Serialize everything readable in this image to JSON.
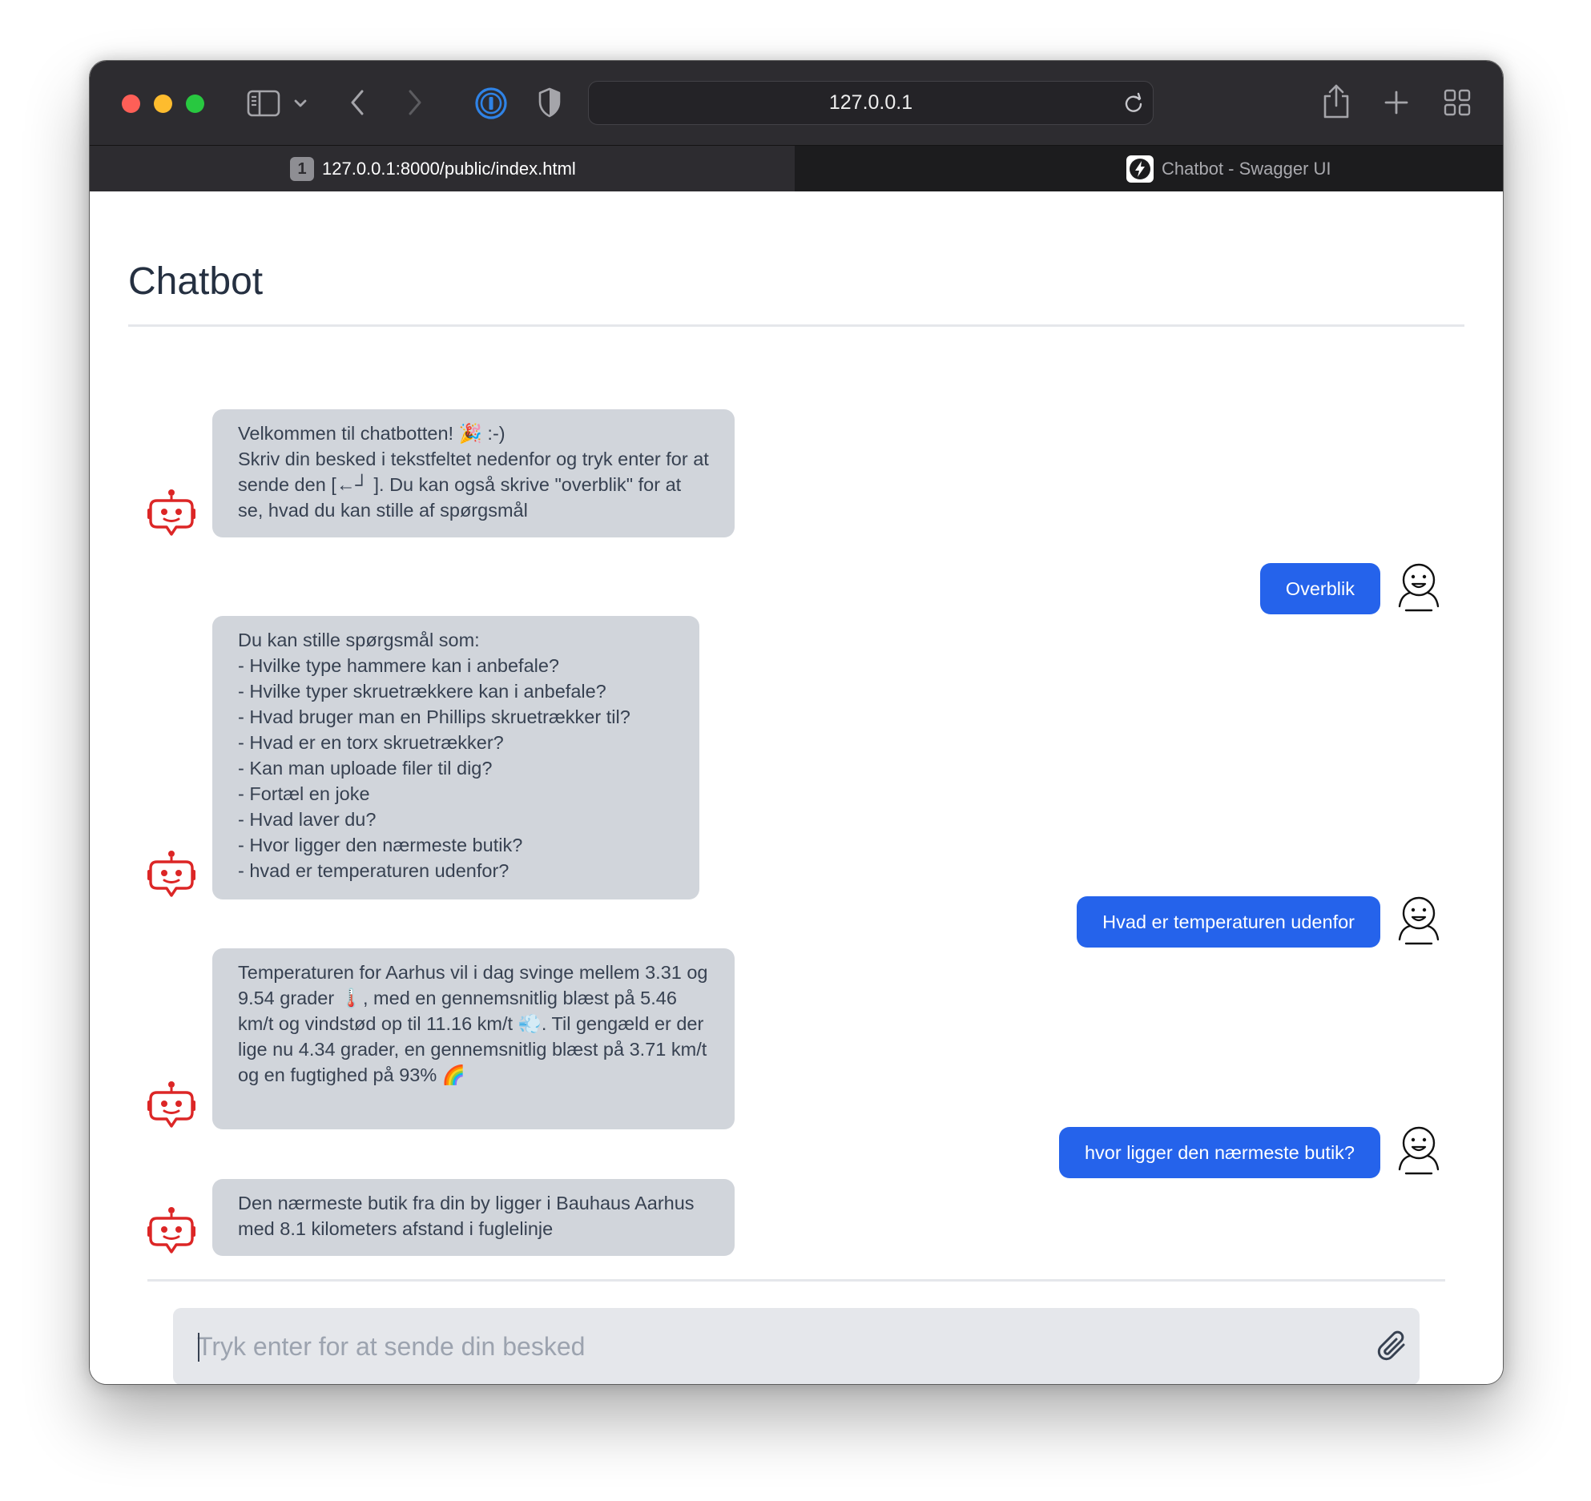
{
  "browser": {
    "address": "127.0.0.1",
    "tabs": [
      {
        "badge": "1",
        "label": "127.0.0.1:8000/public/index.html",
        "active": true
      },
      {
        "label": "Chatbot - Swagger UI",
        "active": false
      }
    ]
  },
  "page": {
    "title": "Chatbot"
  },
  "messages": [
    {
      "sender": "bot",
      "text": "Velkommen til chatbotten! 🎉 :-)\nSkriv din besked i tekstfeltet nedenfor og tryk enter for at sende den [←┘ ]. Du kan også skrive \"overblik\" for at se, hvad du kan stille af spørgsmål"
    },
    {
      "sender": "user",
      "text": "Overblik"
    },
    {
      "sender": "bot",
      "text": "Du kan stille spørgsmål som:\n- Hvilke type hammere kan i anbefale?\n- Hvilke typer skruetrækkere kan i anbefale?\n- Hvad bruger man en Phillips skruetrækker til?\n- Hvad er en torx skruetrækker?\n- Kan man uploade filer til dig?\n- Fortæl en joke\n- Hvad laver du?\n- Hvor ligger den nærmeste butik?\n- hvad er temperaturen udenfor?"
    },
    {
      "sender": "user",
      "text": "Hvad er temperaturen udenfor"
    },
    {
      "sender": "bot",
      "text": "Temperaturen for Aarhus vil i dag svinge mellem 3.31 og 9.54 grader 🌡️, med en gennemsnitlig blæst på 5.46 km/t og vindstød op til 11.16 km/t 💨. Til gengæld er der lige nu 4.34 grader, en gennemsnitlig blæst på 3.71 km/t og en fugtighed på 93% 🌈"
    },
    {
      "sender": "user",
      "text": "hvor ligger den nærmeste butik?"
    },
    {
      "sender": "bot",
      "text": "Den nærmeste butik fra din by ligger i Bauhaus Aarhus med 8.1 kilometers afstand i fuglelinje"
    }
  ],
  "composer": {
    "placeholder": "Tryk enter for at sende din besked",
    "value": ""
  },
  "icons": {
    "bot_avatar": "robot-icon",
    "user_avatar": "person-icon",
    "attach": "paperclip-icon"
  },
  "colors": {
    "user_bubble": "#2563eb",
    "bot_bubble": "#d1d5db",
    "bot_icon": "#dc2626"
  }
}
